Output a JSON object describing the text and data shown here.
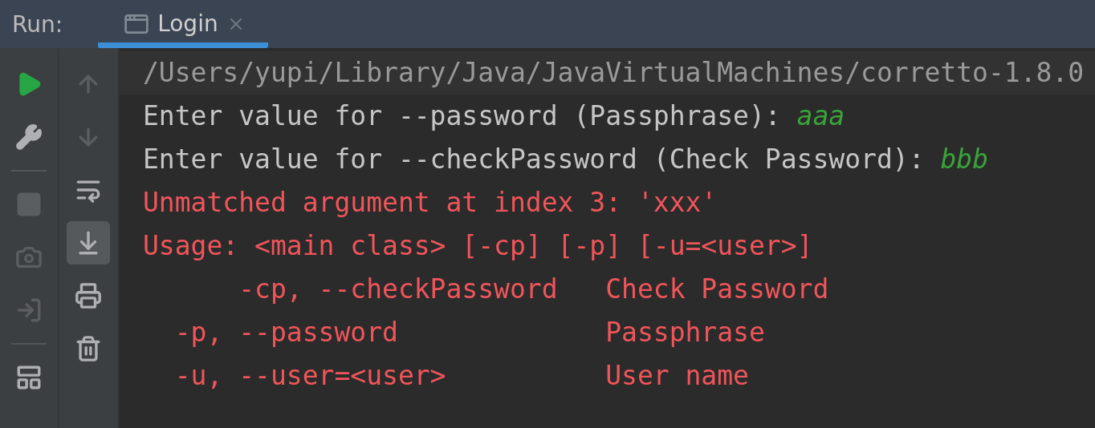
{
  "header": {
    "label": "Run:",
    "tabs": [
      {
        "title": "Login",
        "selected": true
      }
    ]
  },
  "left_toolbar": [
    {
      "kind": "run",
      "disabled": false
    },
    {
      "kind": "settings",
      "disabled": false
    },
    {
      "kind": "separator"
    },
    {
      "kind": "stop",
      "disabled": true
    },
    {
      "kind": "snapshot",
      "disabled": true
    },
    {
      "kind": "attach",
      "disabled": true
    },
    {
      "kind": "separator"
    },
    {
      "kind": "layout",
      "disabled": false
    }
  ],
  "right_toolbar": [
    {
      "kind": "up",
      "disabled": true,
      "selected": false
    },
    {
      "kind": "down",
      "disabled": true,
      "selected": false
    },
    {
      "kind": "wrap",
      "disabled": false,
      "selected": false
    },
    {
      "kind": "scroll-end",
      "disabled": false,
      "selected": true
    },
    {
      "kind": "print",
      "disabled": false,
      "selected": false
    },
    {
      "kind": "clear",
      "disabled": false,
      "selected": false
    }
  ],
  "console": {
    "lines": [
      {
        "kind": "command",
        "text": "/Users/yupi/Library/Java/JavaVirtualMachines/corretto-1.8.0"
      },
      {
        "kind": "prompt",
        "text": "Enter value for --password (Passphrase): ",
        "input": "aaa"
      },
      {
        "kind": "prompt",
        "text": "Enter value for --checkPassword (Check Password): ",
        "input": "bbb"
      },
      {
        "kind": "error",
        "text": "Unmatched argument at index 3: 'xxx'"
      },
      {
        "kind": "error",
        "text": "Usage: <main class> [-cp] [-p] [-u=<user>]"
      },
      {
        "kind": "error",
        "text": "      -cp, --checkPassword   Check Password"
      },
      {
        "kind": "error",
        "text": "  -p, --password             Passphrase"
      },
      {
        "kind": "error",
        "text": "  -u, --user=<user>          User name"
      }
    ]
  }
}
